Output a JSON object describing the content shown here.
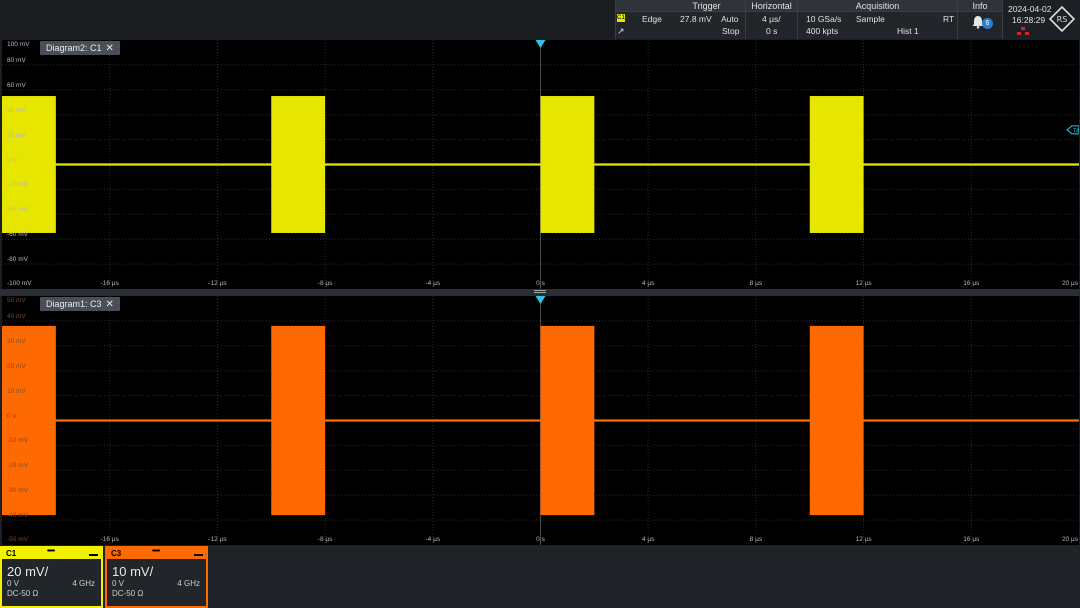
{
  "topbar": {
    "trigger": {
      "header": "Trigger",
      "source_badge": "C1",
      "type": "Edge",
      "level": "27.8 mV",
      "mode": "Auto",
      "state": "Stop"
    },
    "horizontal": {
      "header": "Horizontal",
      "scale": "4 µs/",
      "position": "0 s"
    },
    "acquisition": {
      "header": "Acquisition",
      "sample_rate": "10 GSa/s",
      "mode": "Sample",
      "rt": "RT",
      "record_length": "400 kpts",
      "history": "Hist 1"
    },
    "info": {
      "header": "Info",
      "count": "6"
    },
    "date": "2024-04-02",
    "time": "16:28:29"
  },
  "diagrams": [
    {
      "id": "diag2",
      "tab_label": "Diagram2: C1",
      "close": "✕",
      "color": "#e6e600",
      "y_labels": [
        "100 mV",
        "80 mV",
        "60 mV",
        "40 mV",
        "20 mV",
        "0 V",
        "-20 mV",
        "-40 mV",
        "-60 mV",
        "-80 mV",
        "-100 mV"
      ],
      "x_labels": [
        "-16 µs",
        "-12 µs",
        "-8 µs",
        "-4 µs",
        "0 s",
        "4 µs",
        "8 µs",
        "12 µs",
        "16 µs",
        "20 µs"
      ],
      "trigger_marker": "TA",
      "burst_amplitude_mv": 55,
      "y_range_mv": [
        -100,
        100
      ]
    },
    {
      "id": "diag1",
      "tab_label": "Diagram1: C3",
      "close": "✕",
      "color": "#ff6a00",
      "y_labels": [
        "50 mV",
        "40 mV",
        "30 mV",
        "20 mV",
        "10 mV",
        "0 V",
        "-10 mV",
        "-20 mV",
        "-30 mV",
        "-40 mV",
        "-50 mV"
      ],
      "x_labels": [
        "-16 µs",
        "-12 µs",
        "-8 µs",
        "-4 µs",
        "0 s",
        "4 µs",
        "8 µs",
        "12 µs",
        "16 µs",
        "20 µs"
      ],
      "burst_amplitude_mv": 38,
      "y_range_mv": [
        -50,
        50
      ]
    }
  ],
  "waveform": {
    "x_range_us": [
      -20,
      20
    ],
    "bursts_us": [
      [
        -20,
        -18
      ],
      [
        -10,
        -8
      ],
      [
        0,
        2
      ],
      [
        10,
        12
      ]
    ]
  },
  "channels": [
    {
      "name": "C1",
      "color": "#f2f200",
      "scale": "20 mV/",
      "offset": "0 V",
      "bandwidth": "4 GHz",
      "coupling": "DC-50 Ω",
      "dots": "•••••"
    },
    {
      "name": "C3",
      "color": "#ff6a00",
      "scale": "10 mV/",
      "offset": "0 V",
      "bandwidth": "4 GHz",
      "coupling": "DC-50 Ω",
      "dots": "•••••"
    }
  ]
}
